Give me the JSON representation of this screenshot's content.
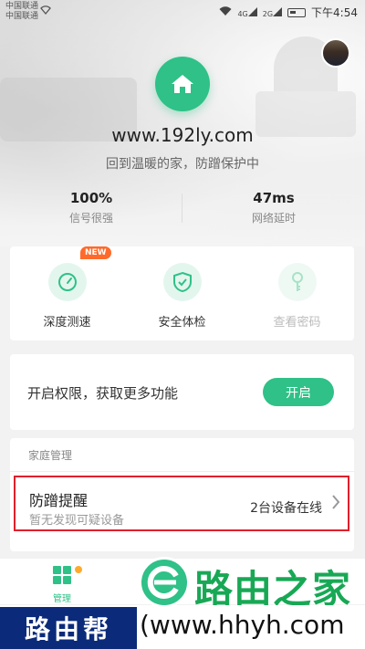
{
  "status_bar": {
    "carrier1": "中国联通",
    "carrier2": "中国联通",
    "signal_text_4g": "4G",
    "signal_text_2g": "2G",
    "time": "下午4:54"
  },
  "header": {
    "domain": "www.192ly.com",
    "tagline": "回到温暖的家，防蹭保护中",
    "stats": [
      {
        "value": "100%",
        "label": "信号很强"
      },
      {
        "value": "47ms",
        "label": "网络延时"
      }
    ]
  },
  "tools": {
    "new_badge": "NEW",
    "items": [
      {
        "label": "深度测速",
        "icon": "speedometer-icon"
      },
      {
        "label": "安全体检",
        "icon": "shield-check-icon"
      },
      {
        "label": "查看密码",
        "icon": "key-icon"
      }
    ]
  },
  "permission": {
    "text": "开启权限，获取更多功能",
    "button": "开启"
  },
  "family": {
    "title": "家庭管理",
    "alert_title": "防蹭提醒",
    "alert_sub": "暂无发现可疑设备",
    "alert_status": "2台设备在线"
  },
  "tabbar": {
    "manage_label": "管理"
  },
  "watermark": {
    "title": "路由之家",
    "box": "路由帮",
    "url": "(www.hhyh.com"
  },
  "colors": {
    "accent": "#2fc187",
    "badge": "#ff6a2b",
    "highlight": "#e0202a"
  }
}
